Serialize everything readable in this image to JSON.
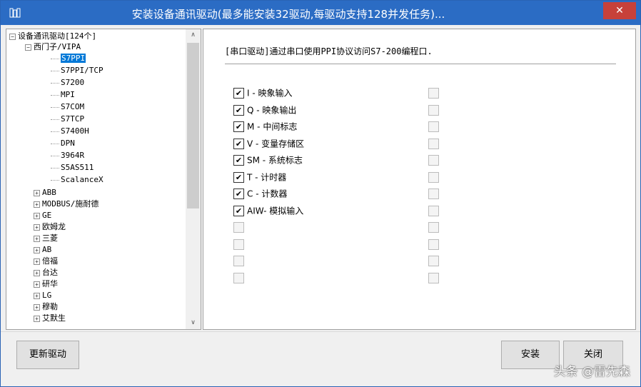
{
  "window": {
    "title": "安装设备通讯驱动(最多能安装32驱动,每驱动支持128并发任务)...",
    "close_label": "✕"
  },
  "tree": {
    "root_label": "设备通讯驱动[124个]",
    "group_label": "西门子/VIPA",
    "children": [
      "S7PPI",
      "S7PPI/TCP",
      "S7200",
      "MPI",
      "S7COM",
      "S7TCP",
      "S7400H",
      "DPN",
      "3964R",
      "S5AS511",
      "ScalanceX"
    ],
    "selected_child": "S7PPI",
    "vendors": [
      "ABB",
      "MODBUS/施耐德",
      "GE",
      "欧姆龙",
      "三菱",
      "AB",
      "倍福",
      "台达",
      "研华",
      "LG",
      "穆勒",
      "艾默生"
    ]
  },
  "scroll": {
    "up_glyph": "∧",
    "down_glyph": "∨"
  },
  "description": "[串口驱动]通过串口使用PPI协议访问S7-200编程口.",
  "registers": [
    {
      "label": "I - 映象输入",
      "checked": true
    },
    {
      "label": "Q - 映象输出",
      "checked": true
    },
    {
      "label": "M - 中间标志",
      "checked": true
    },
    {
      "label": "V - 变量存储区",
      "checked": true
    },
    {
      "label": "SM - 系统标志",
      "checked": true
    },
    {
      "label": "T - 计时器",
      "checked": true
    },
    {
      "label": "C - 计数器",
      "checked": true
    },
    {
      "label": "AIW- 模拟输入",
      "checked": true
    },
    {
      "label": "",
      "checked": false
    },
    {
      "label": "",
      "checked": false
    },
    {
      "label": "",
      "checked": false
    },
    {
      "label": "",
      "checked": false
    }
  ],
  "buttons": {
    "update": "更新驱动",
    "install": "安装",
    "close": "关闭"
  },
  "watermark": "头条 @雷先森"
}
